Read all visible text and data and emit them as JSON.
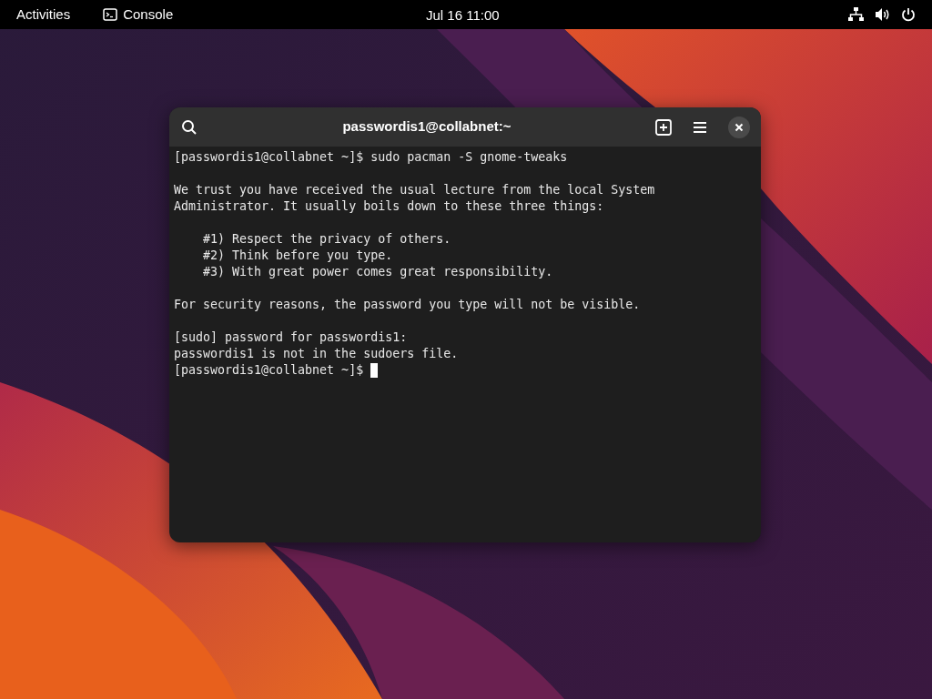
{
  "top_bar": {
    "activities": "Activities",
    "app": "Console",
    "clock": "Jul 16  11:00"
  },
  "terminal": {
    "title": "passwordis1@collabnet:~",
    "paragraphs": [
      [
        "[passwordis1@collabnet ~]$ sudo pacman -S gnome-tweaks"
      ],
      [
        "We trust you have received the usual lecture from the local System",
        "Administrator. It usually boils down to these three things:"
      ],
      [
        "    #1) Respect the privacy of others.",
        "    #2) Think before you type.",
        "    #3) With great power comes great responsibility."
      ],
      [
        "For security reasons, the password you type will not be visible."
      ],
      [
        "[sudo] password for passwordis1:",
        "passwordis1 is not in the sudoers file.",
        "[passwordis1@collabnet ~]$ "
      ]
    ],
    "cursor_visible": true
  }
}
